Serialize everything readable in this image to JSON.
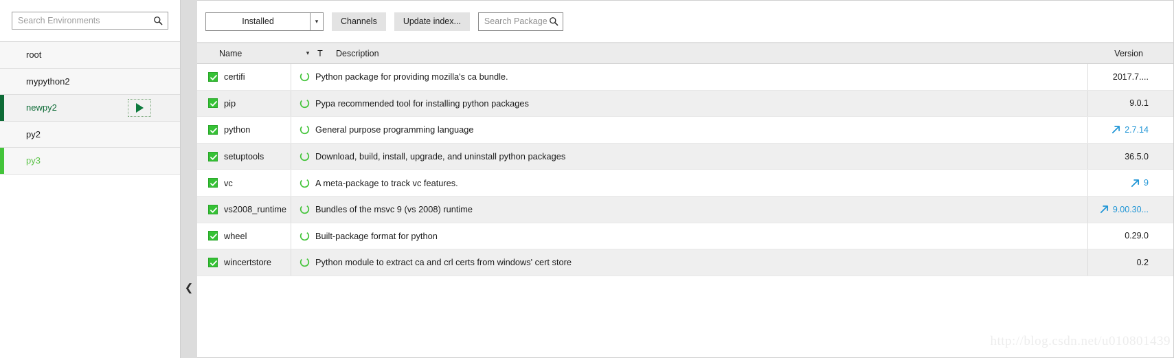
{
  "sidebar": {
    "search": {
      "placeholder": "Search Environments",
      "value": "",
      "icon": "search-icon"
    },
    "environments": [
      {
        "name": "root",
        "state": "normal",
        "has_run_button": false
      },
      {
        "name": "mypython2",
        "state": "normal",
        "has_run_button": false
      },
      {
        "name": "newpy2",
        "state": "selected",
        "has_run_button": true,
        "run_icon": "play-icon"
      },
      {
        "name": "py2",
        "state": "normal",
        "has_run_button": false
      },
      {
        "name": "py3",
        "state": "active",
        "has_run_button": false
      }
    ]
  },
  "splitter": {
    "collapse_icon": "chevron-left-icon"
  },
  "toolbar": {
    "filter_select": {
      "value": "Installed",
      "icon": "chevron-down-icon"
    },
    "channels_label": "Channels",
    "update_index_label": "Update index...",
    "package_search": {
      "placeholder": "Search Packages",
      "value": "",
      "icon": "search-icon"
    }
  },
  "table": {
    "headers": {
      "name": "Name",
      "sort_icon": "chevron-down-icon",
      "type": "T",
      "description": "Description",
      "version": "Version"
    },
    "rows": [
      {
        "checked": true,
        "name": "certifi",
        "description": "Python package for providing mozilla's ca bundle.",
        "version": "2017.7....",
        "upgradable": false
      },
      {
        "checked": true,
        "name": "pip",
        "description": "Pypa recommended tool for installing python packages",
        "version": "9.0.1",
        "upgradable": false
      },
      {
        "checked": true,
        "name": "python",
        "description": "General purpose programming language",
        "version": "2.7.14",
        "upgradable": true
      },
      {
        "checked": true,
        "name": "setuptools",
        "description": "Download, build, install, upgrade, and uninstall python packages",
        "version": "36.5.0",
        "upgradable": false
      },
      {
        "checked": true,
        "name": "vc",
        "description": "A meta-package to track vc features.",
        "version": "9",
        "upgradable": true
      },
      {
        "checked": true,
        "name": "vs2008_runtime",
        "description": "Bundles of the msvc 9 (vs 2008) runtime",
        "version": "9.00.30...",
        "upgradable": true
      },
      {
        "checked": true,
        "name": "wheel",
        "description": "Built-package format for python",
        "version": "0.29.0",
        "upgradable": false
      },
      {
        "checked": true,
        "name": "wincertstore",
        "description": "Python module to extract ca and crl certs from windows' cert store",
        "version": "0.2",
        "upgradable": false
      }
    ]
  },
  "watermark": {
    "text": "http://blog.csdn.net/u010801439"
  },
  "colors": {
    "accent_green": "#43c43a",
    "dark_green": "#0d6b36",
    "checkbox_green": "#35c135",
    "upgrade_blue": "#2196d6",
    "toolbar_button": "#e3e3e3",
    "header_bg": "#ececec"
  }
}
